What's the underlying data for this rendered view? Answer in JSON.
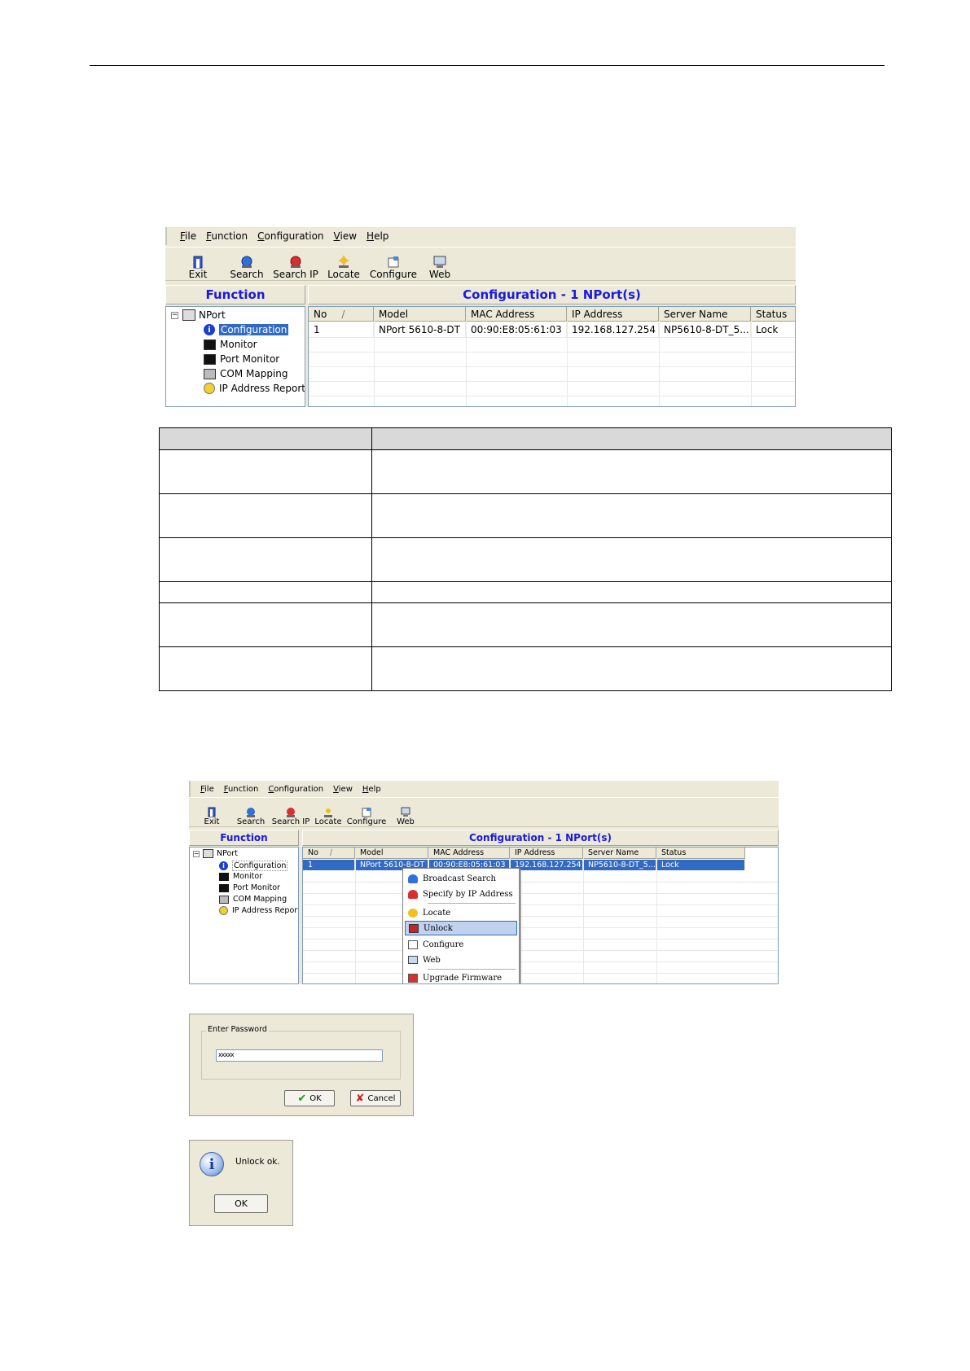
{
  "menu": [
    "File",
    "Function",
    "Configuration",
    "View",
    "Help"
  ],
  "toolbar": [
    "Exit",
    "Search",
    "Search IP",
    "Locate",
    "Configure",
    "Web"
  ],
  "icons": {
    "exit": "exit-icon",
    "search": "search-icon",
    "search_ip": "search-ip-icon",
    "locate": "locate-icon",
    "configure": "configure-icon",
    "web": "web-icon"
  },
  "function_heading": "Function",
  "config_heading": "Configuration - 1 NPort(s)",
  "tree": {
    "root": "NPort",
    "items": [
      "Configuration",
      "Monitor",
      "Port Monitor",
      "COM Mapping",
      "IP Address Report"
    ]
  },
  "columns": [
    "No",
    "Model",
    "MAC Address",
    "IP Address",
    "Server Name",
    "Status"
  ],
  "sort_indicator": "/",
  "row": {
    "no": "1",
    "model": "NPort 5610-8-DT",
    "mac": "00:90:E8:05:61:03",
    "ip": "192.168.127.254",
    "server": "NP5610-8-DT_5...",
    "status": "Lock"
  },
  "row_small": {
    "model": "NPort 5610-8-DT",
    "mac": "00:90:E8:05:61:03",
    "server": "NP5610-8-DT_5..."
  },
  "context_menu": [
    "Broadcast Search",
    "Specify by IP Address",
    "Locate",
    "Unlock",
    "Configure",
    "Web",
    "Upgrade Firmware"
  ],
  "context_selected": "Unlock",
  "password_dialog": {
    "label": "Enter Password",
    "value": "xxxxx",
    "ok": "OK",
    "cancel": "Cancel"
  },
  "info_dialog": {
    "message": "Unlock ok.",
    "ok": "OK"
  },
  "colors": {
    "heading_blue": "#1a1ae0",
    "selection_blue": "#316ac5",
    "window_bg": "#ece9d8"
  }
}
